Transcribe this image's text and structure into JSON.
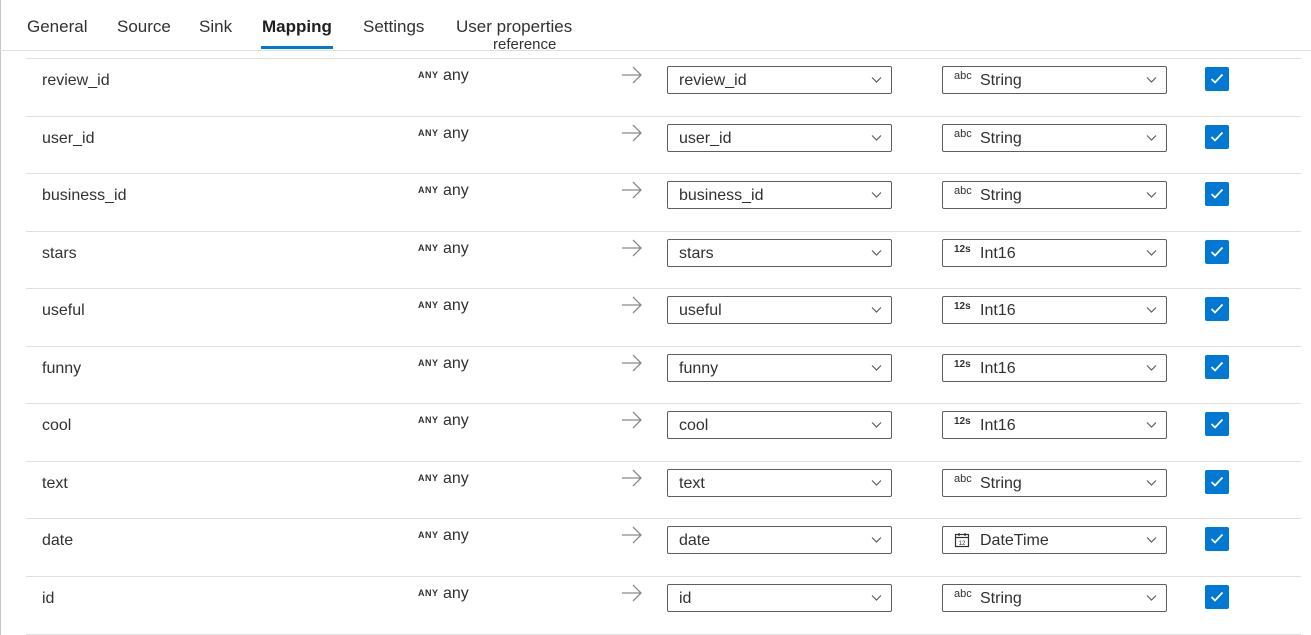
{
  "tabs": [
    {
      "label": "General"
    },
    {
      "label": "Source"
    },
    {
      "label": "Sink"
    },
    {
      "label": "Mapping"
    },
    {
      "label": "Settings"
    },
    {
      "label": "User properties"
    }
  ],
  "active_tab": "Mapping",
  "cutoff_header": "reference",
  "rows": [
    {
      "name": "review_id",
      "tag": "ANY",
      "type": "any",
      "dest": "review_id",
      "dest_type_icon": "abc",
      "dest_type": "String",
      "checked": true
    },
    {
      "name": "user_id",
      "tag": "ANY",
      "type": "any",
      "dest": "user_id",
      "dest_type_icon": "abc",
      "dest_type": "String",
      "checked": true
    },
    {
      "name": "business_id",
      "tag": "ANY",
      "type": "any",
      "dest": "business_id",
      "dest_type_icon": "abc",
      "dest_type": "String",
      "checked": true
    },
    {
      "name": "stars",
      "tag": "ANY",
      "type": "any",
      "dest": "stars",
      "dest_type_icon": "12s",
      "dest_type": "Int16",
      "checked": true
    },
    {
      "name": "useful",
      "tag": "ANY",
      "type": "any",
      "dest": "useful",
      "dest_type_icon": "12s",
      "dest_type": "Int16",
      "checked": true
    },
    {
      "name": "funny",
      "tag": "ANY",
      "type": "any",
      "dest": "funny",
      "dest_type_icon": "12s",
      "dest_type": "Int16",
      "checked": true
    },
    {
      "name": "cool",
      "tag": "ANY",
      "type": "any",
      "dest": "cool",
      "dest_type_icon": "12s",
      "dest_type": "Int16",
      "checked": true
    },
    {
      "name": "text",
      "tag": "ANY",
      "type": "any",
      "dest": "text",
      "dest_type_icon": "abc",
      "dest_type": "String",
      "checked": true
    },
    {
      "name": "date",
      "tag": "ANY",
      "type": "any",
      "dest": "date",
      "dest_type_icon": "calendar-icon",
      "dest_type": "DateTime",
      "checked": true
    },
    {
      "name": "id",
      "tag": "ANY",
      "type": "any",
      "dest": "id",
      "dest_type_icon": "abc",
      "dest_type": "String",
      "checked": true
    }
  ],
  "colors": {
    "accent": "#0078d4",
    "text": "#323130",
    "border": "#605e5c"
  }
}
